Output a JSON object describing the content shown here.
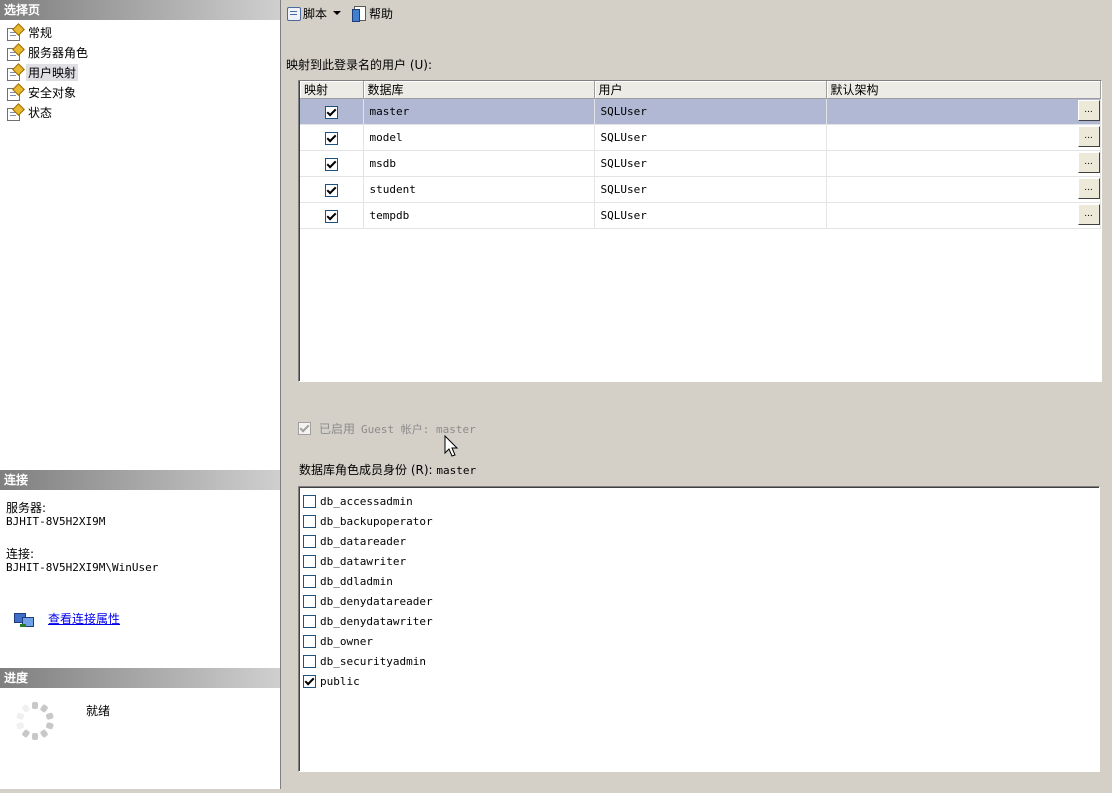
{
  "left_pane": {
    "select_page_header": "选择页",
    "pages": [
      {
        "label": "常规",
        "selected": false
      },
      {
        "label": "服务器角色",
        "selected": false
      },
      {
        "label": "用户映射",
        "selected": true
      },
      {
        "label": "安全对象",
        "selected": false
      },
      {
        "label": "状态",
        "selected": false
      }
    ],
    "connection_header": "连接",
    "server_label": "服务器:",
    "server_value": "BJHIT-8V5H2XI9M",
    "connection_label": "连接:",
    "connection_value": "BJHIT-8V5H2XI9M\\WinUser",
    "view_connection_properties": "查看连接属性",
    "progress_header": "进度",
    "progress_status": "就绪"
  },
  "toolbar": {
    "script_label": "脚本",
    "help_label": "帮助"
  },
  "users_section": {
    "label": "映射到此登录名的用户 (U):",
    "columns": [
      "映射",
      "数据库",
      "用户",
      "默认架构"
    ],
    "rows": [
      {
        "mapped": true,
        "database": "master",
        "user": "SQLUser",
        "schema": "",
        "selected": true
      },
      {
        "mapped": true,
        "database": "model",
        "user": "SQLUser",
        "schema": "",
        "selected": false
      },
      {
        "mapped": true,
        "database": "msdb",
        "user": "SQLUser",
        "schema": "",
        "selected": false
      },
      {
        "mapped": true,
        "database": "student",
        "user": "SQLUser",
        "schema": "",
        "selected": false
      },
      {
        "mapped": true,
        "database": "tempdb",
        "user": "SQLUser",
        "schema": "",
        "selected": false
      }
    ],
    "ellipsis": "..."
  },
  "guest": {
    "checked": true,
    "prefix": "已启用",
    "text": "Guest 帐户: master"
  },
  "roles_section": {
    "label": "数据库角色成员身份 (R):",
    "database": "master",
    "roles": [
      {
        "name": "db_accessadmin",
        "checked": false
      },
      {
        "name": "db_backupoperator",
        "checked": false
      },
      {
        "name": "db_datareader",
        "checked": false
      },
      {
        "name": "db_datawriter",
        "checked": false
      },
      {
        "name": "db_ddladmin",
        "checked": false
      },
      {
        "name": "db_denydatareader",
        "checked": false
      },
      {
        "name": "db_denydatawriter",
        "checked": false
      },
      {
        "name": "db_owner",
        "checked": false
      },
      {
        "name": "db_securityadmin",
        "checked": false
      },
      {
        "name": "public",
        "checked": true
      }
    ]
  },
  "colors": {
    "window_bg": "#d4d0c8",
    "selection_row": "#b1b8d3",
    "link": "#0000ee",
    "header_gradient_dark": "#7f7f7f"
  }
}
